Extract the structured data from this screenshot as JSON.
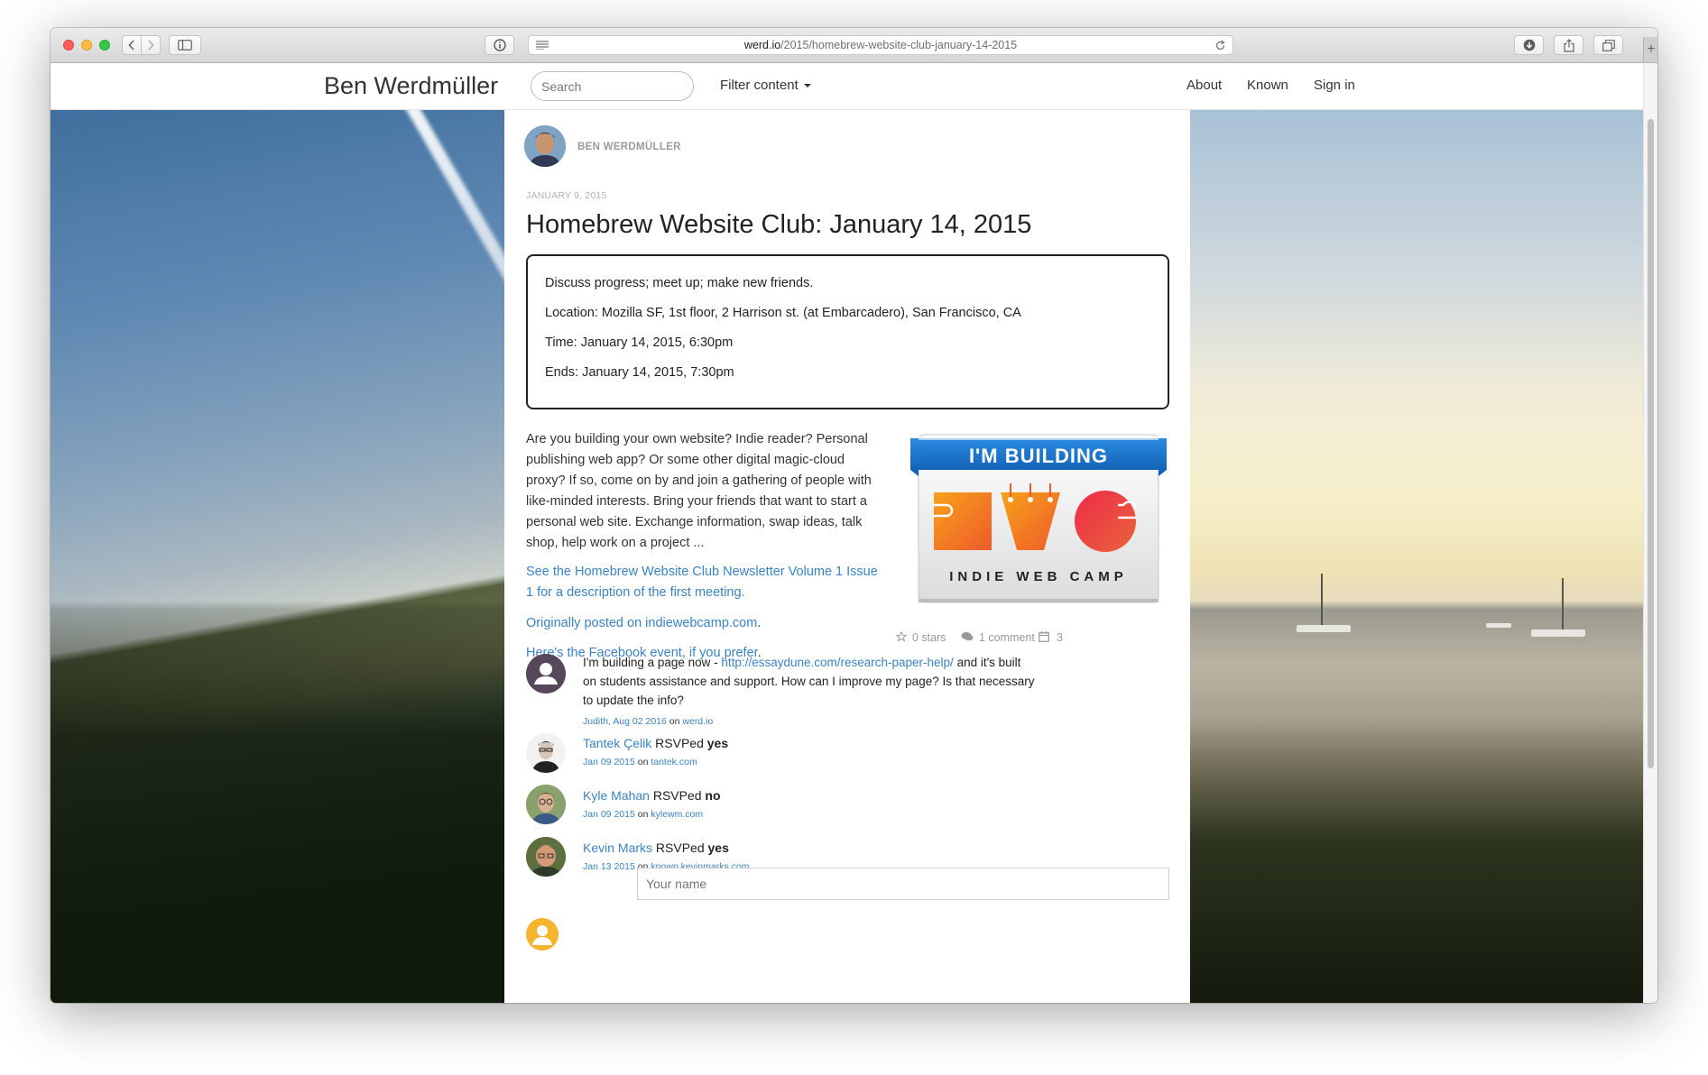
{
  "browser": {
    "url_host": "werd.io",
    "url_path": "/2015/homebrew-website-club-january-14-2015"
  },
  "navbar": {
    "brand": "Ben Werdmüller",
    "search_placeholder": "Search",
    "filter_label": "Filter content",
    "links": [
      "About",
      "Known",
      "Sign in"
    ]
  },
  "post": {
    "author": "BEN WERDMÜLLER",
    "date": "JANUARY 9, 2015",
    "title": "Homebrew Website Club: January 14, 2015",
    "event": {
      "summary": "Discuss progress; meet up; make new friends.",
      "location": "Location: Mozilla SF, 1st floor, 2 Harrison st. (at Embarcadero), San Francisco, CA",
      "time": "Time: January 14, 2015, 6:30pm",
      "ends": "Ends: January 14, 2015, 7:30pm"
    },
    "body_lines": [
      "Are you building your own website? Indie reader? Personal",
      "publishing web app? Or some other digital magic-cloud",
      "proxy? If so, come on by and join a gathering of people with",
      "like-minded interests. Bring your friends that want to start a",
      "personal web site. Exchange information, swap ideas, talk",
      "shop, help work on a project ..."
    ],
    "newsletter_link_line1": "See the Homebrew Website Club Newsletter Volume 1 Issue",
    "newsletter_link_line2": "1 for a description of the first meeting.",
    "original_link": "Originally posted on indiewebcamp.com",
    "original_suffix": ".",
    "facebook_link": "Here's the Facebook event, if you prefer",
    "facebook_suffix": ".",
    "badge": {
      "banner": "I'M BUILDING",
      "caption": "INDIE WEB CAMP"
    }
  },
  "stats": {
    "stars": "0 stars",
    "comments": "1 comment",
    "rsvps": "3"
  },
  "comment": {
    "line1_prefix": "I'm building a page now - ",
    "line1_link": "http://essaydune.com/research-paper-help/",
    "line1_suffix": " and it's built",
    "line2": "on students assistance and support. How can I improve my page? Is that necessary",
    "line3": "to update the info?",
    "author": "Judith",
    "date": "Aug 02 2016",
    "on": "on",
    "site": "werd.io"
  },
  "rsvps": [
    {
      "name": "Tantek Çelik",
      "verb": " RSVPed ",
      "answer": "yes",
      "date": "Jan 09 2015",
      "on": " on ",
      "site": "tantek.com"
    },
    {
      "name": "Kyle Mahan",
      "verb": " RSVPed ",
      "answer": "no",
      "date": "Jan 09 2015",
      "on": " on ",
      "site": "kylewm.com"
    },
    {
      "name": "Kevin Marks",
      "verb": " RSVPed ",
      "answer": "yes",
      "date": "Jan 13 2015",
      "on": " on ",
      "site": "known.kevinmarks.com"
    }
  ],
  "reply_form": {
    "name_placeholder": "Your name"
  }
}
